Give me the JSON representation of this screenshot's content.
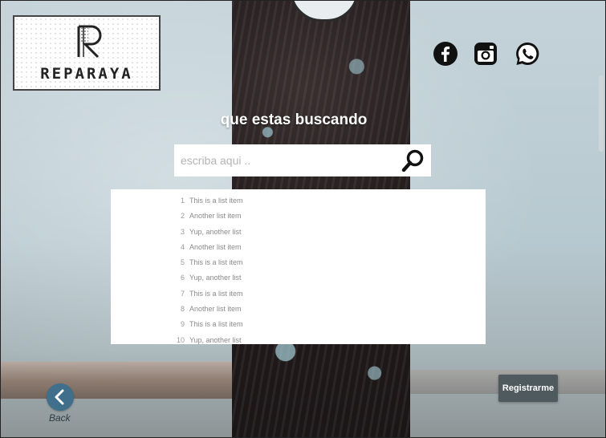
{
  "brand": {
    "logo_mark": "R",
    "name": "REPARAYA"
  },
  "social": [
    {
      "icon": "facebook-icon",
      "color": "#111111"
    },
    {
      "icon": "instagram-icon",
      "color": "#111111"
    },
    {
      "icon": "whatsapp-icon",
      "color": "#111111"
    }
  ],
  "search": {
    "heading": "que estas buscando",
    "placeholder": "escriba aqui ..",
    "button_icon": "search-icon"
  },
  "results": {
    "items": [
      {
        "num": "1",
        "label": "This is a list item"
      },
      {
        "num": "2",
        "label": "Another list item"
      },
      {
        "num": "3",
        "label": "Yup, another list"
      },
      {
        "num": "4",
        "label": "Another list item"
      },
      {
        "num": "5",
        "label": "This is a list item"
      },
      {
        "num": "6",
        "label": "Yup, another list"
      },
      {
        "num": "7",
        "label": "This is a list item"
      },
      {
        "num": "8",
        "label": "Another list item"
      },
      {
        "num": "9",
        "label": "This is a list item"
      },
      {
        "num": "10",
        "label": "Yup, another list"
      }
    ]
  },
  "actions": {
    "register_label": "Registrarme",
    "back_label": "Back"
  },
  "colors": {
    "register_bg": "#4f5a5f",
    "back_bg": "#3f6f8b"
  }
}
